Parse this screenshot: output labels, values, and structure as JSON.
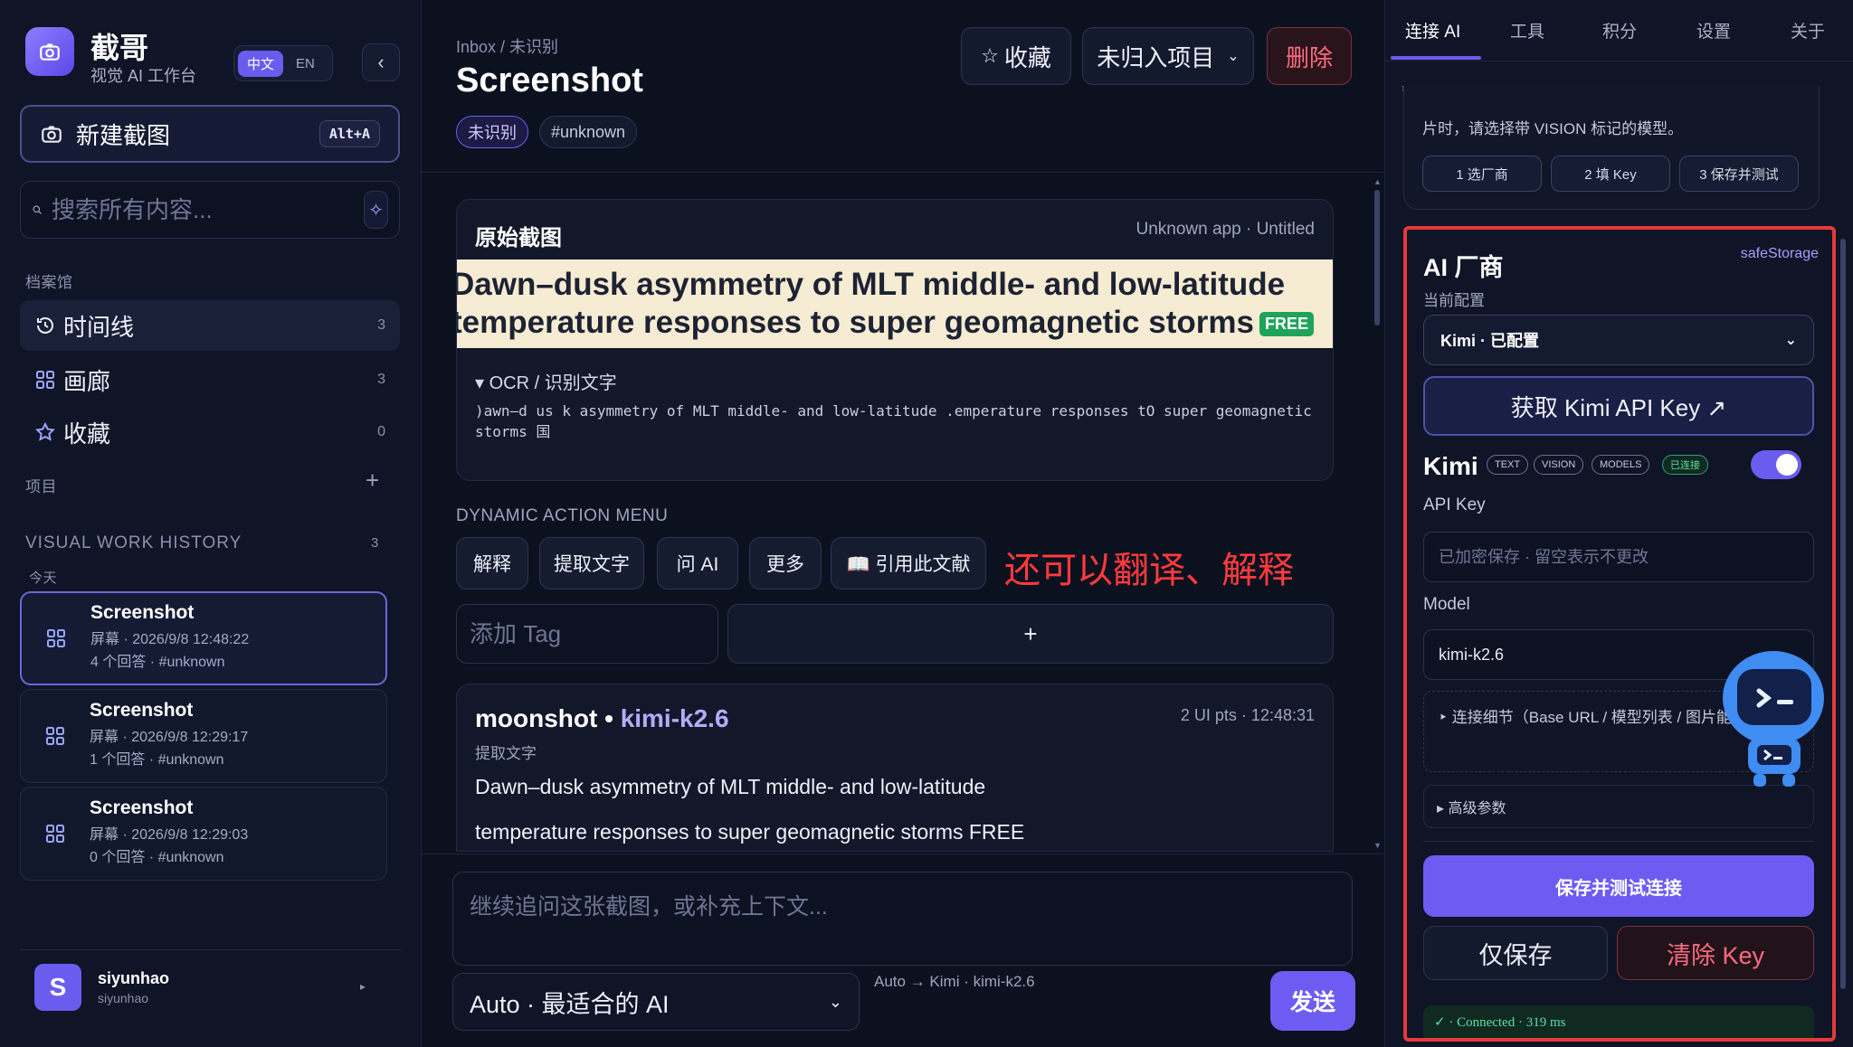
{
  "app": {
    "name": "截哥",
    "subtitle": "视觉 AI 工作台",
    "lang_zh": "中文",
    "lang_en": "EN",
    "collapse_glyph": "‹"
  },
  "sidebar": {
    "new_shot_label": "新建截图",
    "new_shot_shortcut": "Alt+A",
    "search_placeholder": "搜索所有内容...",
    "archive_label": "档案馆",
    "nav": [
      {
        "label": "时间线",
        "count": "3"
      },
      {
        "label": "画廊",
        "count": "3"
      },
      {
        "label": "收藏",
        "count": "0"
      }
    ],
    "projects_label": "项目",
    "projects_add": "+",
    "history_label": "VISUAL WORK HISTORY",
    "history_count": "3",
    "today_label": "今天",
    "history": [
      {
        "title": "Screenshot",
        "time": "屏幕 · 2026/9/8 12:48:22",
        "meta": "4 个回答 · #unknown"
      },
      {
        "title": "Screenshot",
        "time": "屏幕 · 2026/9/8 12:29:17",
        "meta": "1 个回答 · #unknown"
      },
      {
        "title": "Screenshot",
        "time": "屏幕 · 2026/9/8 12:29:03",
        "meta": "0 个回答 · #unknown"
      }
    ],
    "user": {
      "initial": "S",
      "name": "siyunhao",
      "id": "siyunhao",
      "arrow": "▸"
    }
  },
  "main": {
    "breadcrumb": "Inbox / 未识别",
    "title": "Screenshot",
    "tags": [
      "未识别",
      "#unknown"
    ],
    "fav_label": "收藏",
    "project_label": "未归入项目",
    "delete_label": "删除",
    "shot_card": {
      "title": "原始截图",
      "meta": "Unknown app · Untitled",
      "line1": "Dawn–dusk asymmetry of MLT middle- and low-latitude",
      "line2": "temperature responses to super geomagnetic storms",
      "badge": "FREE",
      "ocr_header": "▾ OCR / 识别文字",
      "ocr_text": ")awn—d us k asymmetry of MLT middle- and low-latitude .emperature responses tO super geomagnetic storms 国"
    },
    "dynamic_menu_label": "DYNAMIC ACTION MENU",
    "actions": [
      "解释",
      "提取文字",
      "问 AI",
      "更多",
      "📖 引用此文献"
    ],
    "annotation": "还可以翻译、解释",
    "tag_placeholder": "添加 Tag",
    "tag_add": "+",
    "answer": {
      "provider": "moonshot",
      "sep": " • ",
      "model": "kimi-k2.6",
      "meta": "2 UI pts · 12:48:31",
      "kind": "提取文字",
      "line1": "Dawn–dusk asymmetry of MLT middle- and low-latitude",
      "line2": "temperature responses to super geomagnetic storms FREE"
    },
    "composer_placeholder": "继续追问这张截图，或补充上下文...",
    "model_select": "Auto · 最适合的 AI",
    "route": "Auto → Kimi · kimi-k2.6",
    "send_label": "发送"
  },
  "right": {
    "tabs": [
      "连接 AI",
      "工具",
      "积分",
      "设置",
      "关于"
    ],
    "steps_text": "片时，请选择带 VISION 标记的模型。",
    "steps": [
      "1 选厂商",
      "2 填 Key",
      "3 保存并测试"
    ],
    "ai_title": "AI 厂商",
    "safe_storage": "safeStorage",
    "current_config_label": "当前配置",
    "current_config": "Kimi · 已配置",
    "get_key_label": "获取 Kimi API Key ↗",
    "provider_name": "Kimi",
    "chips": [
      "TEXT",
      "VISION",
      "MODELS",
      "已连接"
    ],
    "api_key_label": "API Key",
    "api_key_placeholder": "已加密保存 · 留空表示不更改",
    "model_label": "Model",
    "model_value": "kimi-k2.6",
    "details": "‣ 连接细节（Base URL / 模型列表 / 图片能力）",
    "advanced": "▸ 高级参数",
    "save_test": "保存并测试连接",
    "save_only": "仅保存",
    "clear_key": "清除 Key",
    "connected": "✓ · Connected · 319 ms"
  },
  "colors": {
    "accent": "#6d5cf2",
    "danger": "#ff6b7e",
    "highlight": "#e53a3a",
    "annotation": "#ff3b3b"
  }
}
